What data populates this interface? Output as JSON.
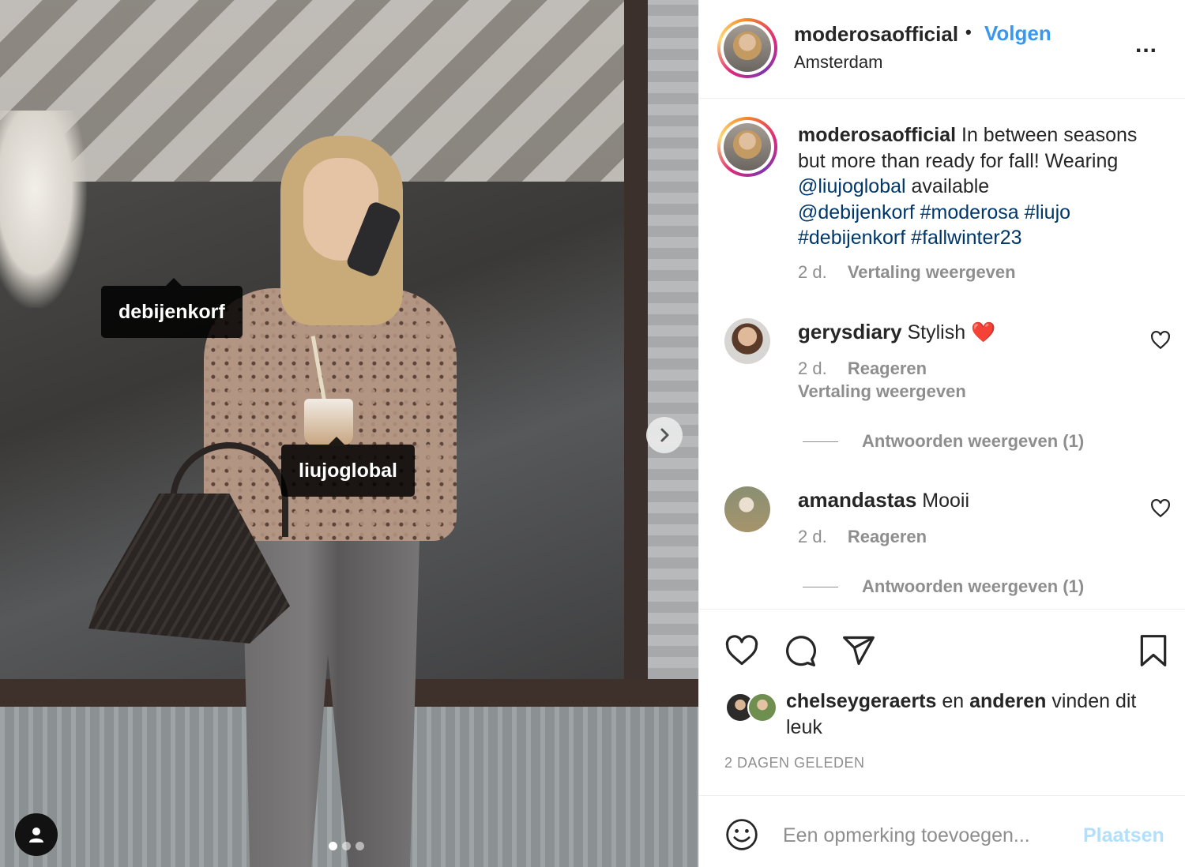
{
  "post": {
    "tags": [
      "debijenkorf",
      "liujoglobal"
    ],
    "carousel": {
      "slide_count": 3,
      "active_index": 0
    }
  },
  "header": {
    "username": "moderosaofficial",
    "separator": "•",
    "follow_label": "Volgen",
    "location": "Amsterdam",
    "more_label": "..."
  },
  "caption": {
    "username": "moderosaofficial",
    "text_1": " In between seasons but more than ready for fall! Wearing ",
    "mention_1": "@liujoglobal",
    "text_2": " available ",
    "mention_2": "@debijenkorf",
    "hashtag_1": "#moderosa",
    "hashtag_2": "#liujo",
    "hashtag_3": "#debijenkorf",
    "hashtag_4": "#fallwinter23",
    "time": "2 d.",
    "translate_label": "Vertaling weergeven"
  },
  "comments": [
    {
      "username": "gerysdiary",
      "text": "Stylish",
      "emoji": "❤️",
      "time": "2 d.",
      "reply_label": "Reageren",
      "translate_label": "Vertaling weergeven",
      "replies_label": "Antwoorden weergeven (1)"
    },
    {
      "username": "amandastas",
      "text": "Mooii",
      "time": "2 d.",
      "reply_label": "Reageren",
      "replies_label": "Antwoorden weergeven (1)"
    }
  ],
  "likes": {
    "user": "chelseygeraerts",
    "connector": "en",
    "others": "anderen",
    "suffix": "vinden dit leuk"
  },
  "timestamp": "2 DAGEN GELEDEN",
  "add_comment": {
    "placeholder": "Een opmerking toevoegen...",
    "post_label": "Plaatsen"
  },
  "colors": {
    "accent": "#3897f0",
    "link": "#00376b",
    "muted": "#8e8e8e",
    "post_disabled": "#b2dffc"
  },
  "icons": [
    "heart-icon",
    "comment-icon",
    "share-icon",
    "bookmark-icon",
    "emoji-icon",
    "user-tag-icon",
    "chevron-right-icon",
    "more-icon"
  ]
}
